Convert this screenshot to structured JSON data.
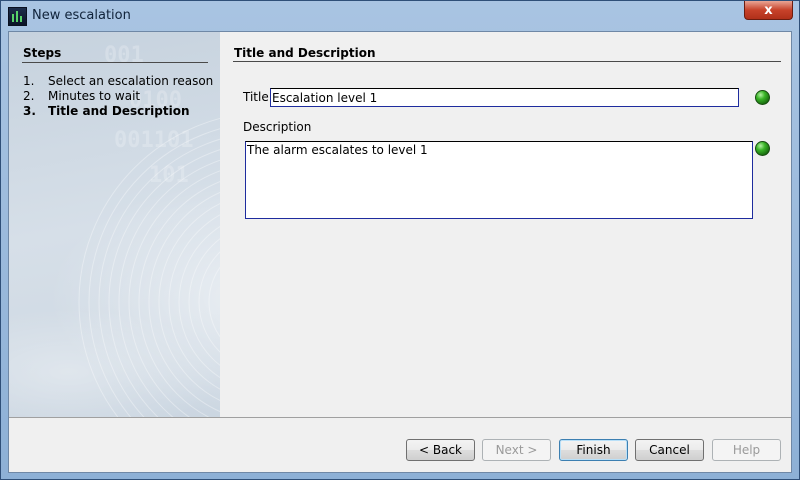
{
  "window": {
    "title": "New escalation",
    "close_label": "x"
  },
  "steps": {
    "title": "Steps",
    "items": [
      {
        "num": "1.",
        "label": "Select an escalation reason"
      },
      {
        "num": "2.",
        "label": "Minutes to wait"
      },
      {
        "num": "3.",
        "label": "Title and Description"
      }
    ],
    "current_index": 2
  },
  "panel": {
    "heading": "Title and Description",
    "title_label": "Title",
    "title_value": "Escalation level 1",
    "description_label": "Description",
    "description_value": "The alarm escalates to level 1"
  },
  "buttons": {
    "back": "< Back",
    "next": "Next >",
    "finish": "Finish",
    "cancel": "Cancel",
    "help": "Help"
  },
  "icons": {
    "app": "app-logo-icon",
    "title_status": "valid-indicator-icon",
    "description_status": "valid-indicator-icon"
  },
  "colors": {
    "title_bar": "#a9c4e2",
    "valid_indicator": "#39b427",
    "input_border": "#1e2c9e",
    "close_button": "#c7422a"
  }
}
